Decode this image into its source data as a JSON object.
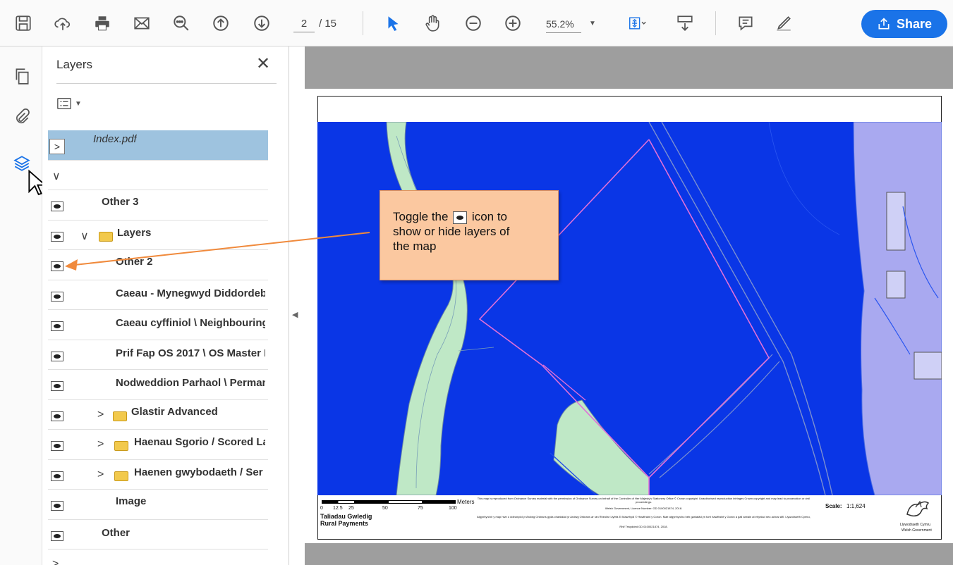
{
  "toolbar": {
    "page_current": "2",
    "page_total": "/ 15",
    "zoom": "55.2%",
    "share_label": "Share",
    "icons": [
      "save-icon",
      "upload-icon",
      "print-icon",
      "email-icon",
      "zoom-search-icon",
      "page-up-icon",
      "page-down-icon",
      "select-arrow-icon",
      "hand-icon",
      "zoom-out-icon",
      "zoom-in-icon",
      "fit-page-icon",
      "scroll-mode-icon",
      "comment-icon",
      "highlight-pen-icon",
      "share-icon"
    ]
  },
  "rail": {
    "icons": [
      "pages-icon",
      "attachment-icon",
      "layers-icon"
    ]
  },
  "panel": {
    "title": "Layers",
    "close": "✕",
    "rows": [
      {
        "label": "Index.pdf",
        "selected": true,
        "kind": "root"
      },
      {
        "label": "",
        "kind": "expanded"
      },
      {
        "label": "Other 3",
        "eye": true
      },
      {
        "label": "Layers",
        "eye": true,
        "folder": true,
        "chev": "∨"
      },
      {
        "label": "Other 2",
        "eye": true
      },
      {
        "label": "Caeau - Mynegwyd Diddordeb",
        "eye": true
      },
      {
        "label": "Caeau cyffiniol \\ Neighbouring",
        "eye": true
      },
      {
        "label": "Prif Fap OS 2017 \\ OS Master M",
        "eye": true
      },
      {
        "label": "Nodweddion Parhaol \\ Perman",
        "eye": true
      },
      {
        "label": "Glastir Advanced",
        "eye": true,
        "folder": true,
        "chev": ">"
      },
      {
        "label": "Haenau Sgorio  / Scored La",
        "eye": true,
        "folder": true,
        "chev": ">"
      },
      {
        "label": "Haenen gwybodaeth  / Ser",
        "eye": true,
        "folder": true,
        "chev": ">"
      },
      {
        "label": "Image",
        "eye": true
      },
      {
        "label": "Other",
        "eye": true
      },
      {
        "label": "",
        "kind": "collapsed"
      }
    ]
  },
  "callout": {
    "line1_a": "Toggle the",
    "line1_b": "icon to",
    "line2": "show or hide layers of",
    "line3": "the map"
  },
  "map_legend": {
    "units": "Meters",
    "ticks": [
      "0",
      "12.5",
      "25",
      "50",
      "75",
      "100"
    ],
    "org_cy": "Taliadau Gwledig",
    "org_en": "Rural Payments",
    "scale_label": "Scale:",
    "scale_value": "1:1,624",
    "copyright_en": "This map is reproduced from Ordnance Survey material with the permission of Ordnance Survey on behalf of the Controller of Her Majesty's Stationery Office © Crown copyright. Unauthorised reproduction infringes Crown copyright and may lead to prosecution or civil proceedings.",
    "copyright_en2": "Welsh Government, Licence Number: GD 0100021874, 2018.",
    "copyright_cy": "Atgynhyrchir y map hwn o ddeunydd yr Arolwg Ordnans gyda chaniatâd yr Arolwg Ordnans ar ran Rheolwr Llyfrfa Ei Mawrhydi © Hawlfraint y Goron. Mae atgynhyrchu heb ganiatâd yn torri hawlfraint y Goron a gall arwain at erlyniad neu achos sifil. Llywodraeth Cymru,",
    "copyright_cy2": "Rhif Trwydded GD 0100021874, 2018.",
    "gov_cy": "Llywodraeth Cymru",
    "gov_en": "Welsh Government"
  },
  "colors": {
    "map_water": "#0a36e6",
    "map_green": "#bfe8c6",
    "map_lavender": "#a9a9f0",
    "boundary_pink": "#e070d8",
    "share_blue": "#1a73e8",
    "callout_fill": "#fbc8a0",
    "callout_arrow": "#f08a3c",
    "selected_row": "#9ec3df"
  }
}
